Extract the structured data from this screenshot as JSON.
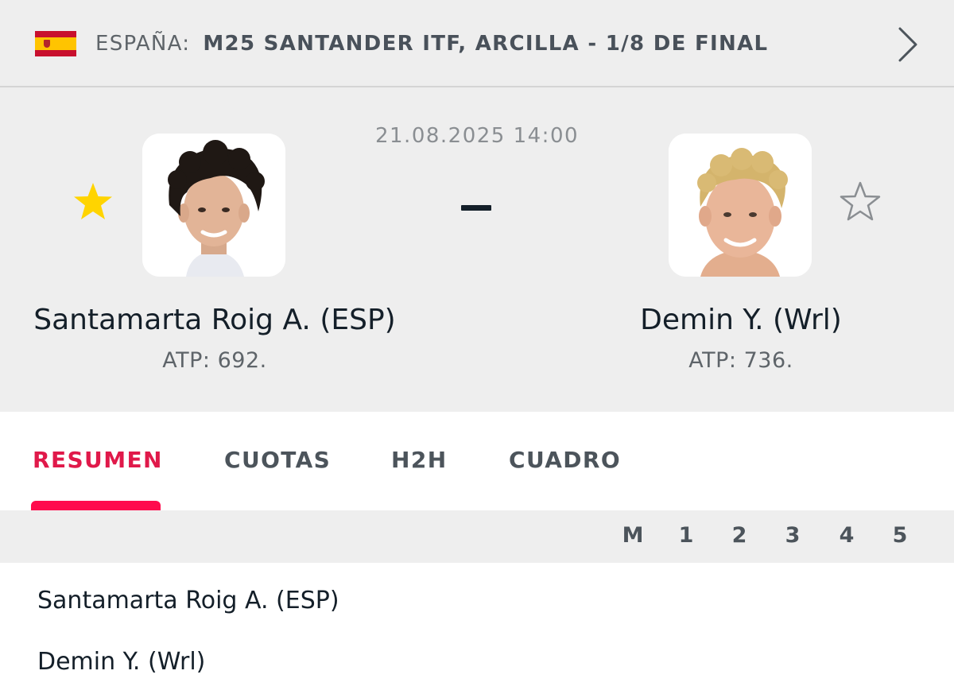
{
  "competition": {
    "country": "ESPAÑA:",
    "name": "M25 SANTANDER ITF, ARCILLA - 1/8 DE FINAL",
    "flag_icon": "spain-flag-icon"
  },
  "match": {
    "datetime": "21.08.2025 14:00",
    "score_separator": "-",
    "home": {
      "name": "Santamarta Roig A. (ESP)",
      "ranking": "ATP: 692.",
      "favorite": true
    },
    "away": {
      "name": "Demin Y. (Wrl)",
      "ranking": "ATP: 736.",
      "favorite": false
    }
  },
  "tabs": [
    {
      "label": "RESUMEN",
      "active": true
    },
    {
      "label": "CUOTAS",
      "active": false
    },
    {
      "label": "H2H",
      "active": false
    },
    {
      "label": "CUADRO",
      "active": false
    }
  ],
  "score_table": {
    "columns": [
      "M",
      "1",
      "2",
      "3",
      "4",
      "5"
    ],
    "rows": [
      {
        "player": "Santamarta Roig A. (ESP)"
      },
      {
        "player": "Demin Y. (Wrl)"
      }
    ]
  },
  "colors": {
    "accent": "#e0194a",
    "favorite_star": "#ffd400",
    "background": "#eeeeee"
  }
}
